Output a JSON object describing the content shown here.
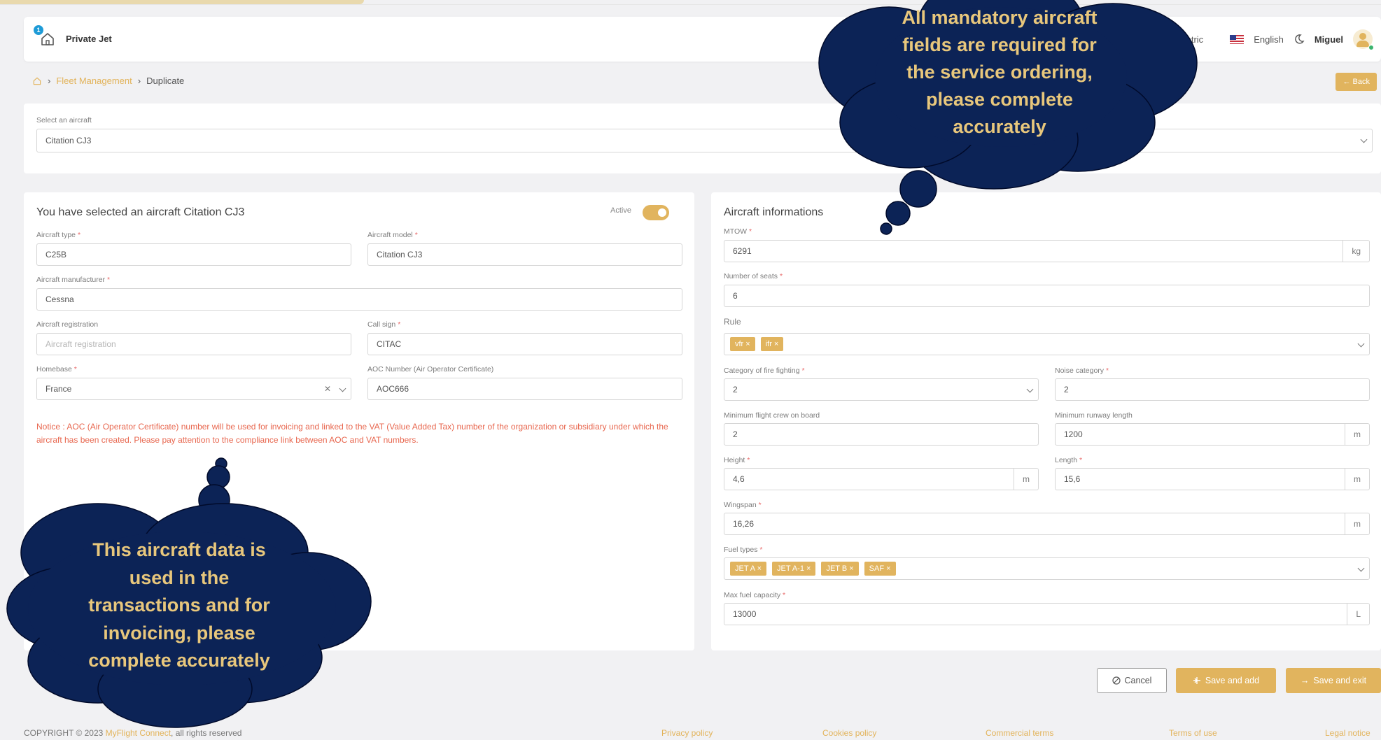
{
  "navbar": {
    "notification_count": "1",
    "brand": "Private Jet",
    "metric_partial": "etric",
    "language": "English",
    "user": "Miguel"
  },
  "breadcrumb": {
    "section": "Fleet Management",
    "page": "Duplicate"
  },
  "back_label": "← Back",
  "aircraft_select": {
    "label": "Select an aircraft",
    "value": "Citation CJ3"
  },
  "left_panel": {
    "title": "You have selected an aircraft Citation CJ3",
    "active_label": "Active",
    "aircraft_type": {
      "label": "Aircraft type",
      "value": "C25B"
    },
    "aircraft_model": {
      "label": "Aircraft model",
      "value": "Citation CJ3"
    },
    "manufacturer": {
      "label": "Aircraft manufacturer",
      "value": "Cessna"
    },
    "registration": {
      "label": "Aircraft registration",
      "placeholder": "Aircraft registration"
    },
    "call_sign": {
      "label": "Call sign",
      "value": "CITAC"
    },
    "homebase": {
      "label": "Homebase",
      "value": "France"
    },
    "aoc_number": {
      "label": "AOC Number (Air Operator Certificate)",
      "value": "AOC666"
    },
    "notice": "Notice : AOC (Air Operator Certificate) number will be used for invoicing and linked to the VAT (Value Added Tax) number of the organization or subsidiary under which the aircraft has been created. Please pay attention to the compliance link between AOC and VAT numbers."
  },
  "right_panel": {
    "title": "Aircraft informations",
    "mtow": {
      "label": "MTOW",
      "value": "6291",
      "unit": "kg"
    },
    "seats": {
      "label": "Number of seats",
      "value": "6"
    },
    "rule": {
      "label": "Rule",
      "tags": [
        "vfr ×",
        "ifr ×"
      ]
    },
    "fire_category": {
      "label": "Category of fire fighting",
      "value": "2"
    },
    "noise_category": {
      "label": "Noise category",
      "value": "2"
    },
    "min_crew": {
      "label": "Minimum flight crew on board",
      "value": "2"
    },
    "min_runway": {
      "label": "Minimum runway length",
      "value": "1200",
      "unit": "m"
    },
    "height": {
      "label": "Height",
      "value": "4,6",
      "unit": "m"
    },
    "length": {
      "label": "Length",
      "value": "15,6",
      "unit": "m"
    },
    "wingspan": {
      "label": "Wingspan",
      "value": "16,26",
      "unit": "m"
    },
    "fuel_types": {
      "label": "Fuel types",
      "tags": [
        "JET A ×",
        "JET A-1 ×",
        "JET B ×",
        "SAF ×"
      ]
    },
    "max_fuel": {
      "label": "Max fuel capacity",
      "value": "13000",
      "unit": "L"
    }
  },
  "actions": {
    "cancel": "Cancel",
    "save_add": "Save and add",
    "save_exit": "Save and exit"
  },
  "footer": {
    "copyright_prefix": "COPYRIGHT © 2023 ",
    "company": "MyFlight Connect",
    "copyright_suffix": ", all rights reserved",
    "links": [
      "Privacy policy",
      "Cookies policy",
      "Commercial terms",
      "Terms of use",
      "Legal notice"
    ]
  },
  "callouts": {
    "top_right": [
      "All mandatory aircraft",
      "fields are required for",
      "the service ordering,",
      "please complete",
      "accurately"
    ],
    "bottom_left": [
      "This aircraft data is",
      "used in the",
      "transactions and for",
      "invoicing, please",
      "complete accurately"
    ]
  },
  "colors": {
    "accent": "#e1b45e",
    "cloud": "#0c2356",
    "cloud_text": "#e8c77c",
    "notice": "#e8674f",
    "background": "#f1f1f3"
  }
}
